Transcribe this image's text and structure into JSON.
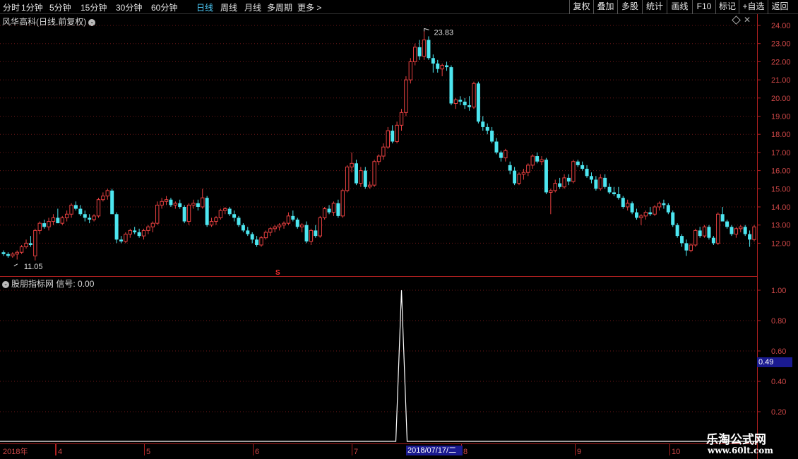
{
  "toolbar": {
    "periods": [
      "分时",
      "1分钟",
      "5分钟",
      "15分钟",
      "30分钟",
      "60分钟",
      "日线",
      "周线",
      "月线",
      "多周期",
      "更多 >"
    ],
    "active_period": "日线",
    "right_buttons": [
      "复权",
      "叠加",
      "多股",
      "统计",
      "画线",
      "F10",
      "标记",
      "+自选",
      "返回"
    ]
  },
  "main_panel": {
    "title": "风华高科(日线,前复权)",
    "y_ticks": [
      "24.00",
      "23.00",
      "22.00",
      "21.00",
      "20.00",
      "19.00",
      "18.00",
      "17.00",
      "16.00",
      "15.00",
      "14.00",
      "13.00",
      "12.00"
    ],
    "high_label": "23.83",
    "low_label": "11.05",
    "signal_mark": "S"
  },
  "indicator_panel": {
    "title": "股朋指标网",
    "signal_label": "信号: 0.00",
    "y_ticks": [
      "1.00",
      "0.80",
      "0.60",
      "0.40",
      "0.20"
    ],
    "cursor_value": "0.49"
  },
  "date_axis": {
    "year": "2018年",
    "months": [
      "4",
      "5",
      "6",
      "7",
      "8",
      "9",
      "10"
    ],
    "cursor_date": "2018/07/17/二"
  },
  "watermark": {
    "name": "乐淘公式网",
    "url": "www.60lt.com"
  },
  "chart_data": {
    "type": "candlestick",
    "y_range": [
      11.0,
      24.3
    ],
    "up_color": "#e84040",
    "down_color": "#4de6f0",
    "candles": [
      [
        11.5,
        11.6,
        11.3,
        11.4
      ],
      [
        11.4,
        11.5,
        11.2,
        11.3
      ],
      [
        11.3,
        11.5,
        11.2,
        11.4
      ],
      [
        11.4,
        11.6,
        11.1,
        11.5
      ],
      [
        11.5,
        11.9,
        11.4,
        11.8
      ],
      [
        11.8,
        12.2,
        11.7,
        12.0
      ],
      [
        12.0,
        12.4,
        11.8,
        11.9
      ],
      [
        11.3,
        12.8,
        11.05,
        12.7
      ],
      [
        12.7,
        13.2,
        12.5,
        13.1
      ],
      [
        13.1,
        13.3,
        12.8,
        12.9
      ],
      [
        12.9,
        13.4,
        12.7,
        13.2
      ],
      [
        13.2,
        13.6,
        13.0,
        13.4
      ],
      [
        13.4,
        13.9,
        13.2,
        13.1
      ],
      [
        13.1,
        13.5,
        13.0,
        13.4
      ],
      [
        13.4,
        13.8,
        13.2,
        13.6
      ],
      [
        13.6,
        14.2,
        13.4,
        14.1
      ],
      [
        14.1,
        14.3,
        13.8,
        13.9
      ],
      [
        13.9,
        14.1,
        13.5,
        13.6
      ],
      [
        13.6,
        13.8,
        13.2,
        13.4
      ],
      [
        13.4,
        13.6,
        13.1,
        13.3
      ],
      [
        13.3,
        13.6,
        13.2,
        13.5
      ],
      [
        13.5,
        14.5,
        13.4,
        14.4
      ],
      [
        14.4,
        14.8,
        14.3,
        14.6
      ],
      [
        14.6,
        15.0,
        14.4,
        14.9
      ],
      [
        14.9,
        15.0,
        13.9,
        13.6
      ],
      [
        13.6,
        13.7,
        12.0,
        12.2
      ],
      [
        12.2,
        12.4,
        12.0,
        12.1
      ],
      [
        12.1,
        12.6,
        12.0,
        12.5
      ],
      [
        12.5,
        12.8,
        12.3,
        12.7
      ],
      [
        12.7,
        12.9,
        12.5,
        12.6
      ],
      [
        12.6,
        12.8,
        12.3,
        12.4
      ],
      [
        12.4,
        12.8,
        12.2,
        12.7
      ],
      [
        12.7,
        13.0,
        12.5,
        12.9
      ],
      [
        12.9,
        13.2,
        12.6,
        13.1
      ],
      [
        13.1,
        14.3,
        13.0,
        14.1
      ],
      [
        14.1,
        14.5,
        13.9,
        14.3
      ],
      [
        14.3,
        14.6,
        14.1,
        14.4
      ],
      [
        14.4,
        14.5,
        14.0,
        14.1
      ],
      [
        14.1,
        14.3,
        13.9,
        14.2
      ],
      [
        14.2,
        14.4,
        13.9,
        14.0
      ],
      [
        14.0,
        14.1,
        13.1,
        13.2
      ],
      [
        13.2,
        14.2,
        13.0,
        14.1
      ],
      [
        14.1,
        14.4,
        13.9,
        14.2
      ],
      [
        14.2,
        14.4,
        13.8,
        14.0
      ],
      [
        14.0,
        15.0,
        13.9,
        14.5
      ],
      [
        14.5,
        14.6,
        12.9,
        13.0
      ],
      [
        13.0,
        13.4,
        12.9,
        13.2
      ],
      [
        13.2,
        13.5,
        13.0,
        13.4
      ],
      [
        13.4,
        13.9,
        13.3,
        13.8
      ],
      [
        13.8,
        14.0,
        13.6,
        13.9
      ],
      [
        13.9,
        14.0,
        13.5,
        13.6
      ],
      [
        13.6,
        13.8,
        13.2,
        13.4
      ],
      [
        13.4,
        13.5,
        12.9,
        13.0
      ],
      [
        13.0,
        13.1,
        12.6,
        12.7
      ],
      [
        12.7,
        12.9,
        12.4,
        12.5
      ],
      [
        12.5,
        12.6,
        12.0,
        12.2
      ],
      [
        12.2,
        12.4,
        11.8,
        11.9
      ],
      [
        11.9,
        12.4,
        11.8,
        12.3
      ],
      [
        12.3,
        12.7,
        12.2,
        12.6
      ],
      [
        12.6,
        12.9,
        12.4,
        12.8
      ],
      [
        12.8,
        13.0,
        12.6,
        12.9
      ],
      [
        12.9,
        13.1,
        12.7,
        13.0
      ],
      [
        13.0,
        13.2,
        12.8,
        13.1
      ],
      [
        13.1,
        13.7,
        13.0,
        13.5
      ],
      [
        13.5,
        13.8,
        13.2,
        13.3
      ],
      [
        13.3,
        13.4,
        12.8,
        12.9
      ],
      [
        12.9,
        13.1,
        12.6,
        13.0
      ],
      [
        13.0,
        13.2,
        12.0,
        12.1
      ],
      [
        12.1,
        12.8,
        11.9,
        12.7
      ],
      [
        12.7,
        13.0,
        12.3,
        12.4
      ],
      [
        12.4,
        13.5,
        12.3,
        13.4
      ],
      [
        13.4,
        14.0,
        13.3,
        13.9
      ],
      [
        13.9,
        14.1,
        13.6,
        13.7
      ],
      [
        13.7,
        14.3,
        13.5,
        14.2
      ],
      [
        14.2,
        14.4,
        13.4,
        13.5
      ],
      [
        13.5,
        15.0,
        13.4,
        14.9
      ],
      [
        14.9,
        16.3,
        14.8,
        16.2
      ],
      [
        16.2,
        17.0,
        15.9,
        16.4
      ],
      [
        16.4,
        16.6,
        15.2,
        15.3
      ],
      [
        15.3,
        16.2,
        15.1,
        16.0
      ],
      [
        16.0,
        16.2,
        15.0,
        15.1
      ],
      [
        15.1,
        15.4,
        15.0,
        15.2
      ],
      [
        15.2,
        16.6,
        15.1,
        16.5
      ],
      [
        16.5,
        16.9,
        16.3,
        16.8
      ],
      [
        16.8,
        17.5,
        16.6,
        17.3
      ],
      [
        17.3,
        18.4,
        17.2,
        18.2
      ],
      [
        18.2,
        18.5,
        17.5,
        17.6
      ],
      [
        17.6,
        18.7,
        17.5,
        18.5
      ],
      [
        18.5,
        19.4,
        18.2,
        19.2
      ],
      [
        19.2,
        21.2,
        19.0,
        21.0
      ],
      [
        21.0,
        22.2,
        20.8,
        22.0
      ],
      [
        22.0,
        23.0,
        21.8,
        22.8
      ],
      [
        22.8,
        23.2,
        22.1,
        22.3
      ],
      [
        22.3,
        23.83,
        22.1,
        23.2
      ],
      [
        23.2,
        23.4,
        22.1,
        22.2
      ],
      [
        22.2,
        22.4,
        21.4,
        21.9
      ],
      [
        21.9,
        22.1,
        21.4,
        21.6
      ],
      [
        21.6,
        21.9,
        21.2,
        21.8
      ],
      [
        21.8,
        22.0,
        21.5,
        21.7
      ],
      [
        21.7,
        21.8,
        19.6,
        19.7
      ],
      [
        19.7,
        20.0,
        19.4,
        19.9
      ],
      [
        19.9,
        20.1,
        19.6,
        19.8
      ],
      [
        19.8,
        20.0,
        19.4,
        19.6
      ],
      [
        19.6,
        20.1,
        19.3,
        19.5
      ],
      [
        19.5,
        20.9,
        19.4,
        20.8
      ],
      [
        20.8,
        20.9,
        18.6,
        18.7
      ],
      [
        18.7,
        19.0,
        18.2,
        18.4
      ],
      [
        18.4,
        18.6,
        18.0,
        18.2
      ],
      [
        18.2,
        18.4,
        17.5,
        17.6
      ],
      [
        17.6,
        17.8,
        16.9,
        17.0
      ],
      [
        17.0,
        17.1,
        16.5,
        16.7
      ],
      [
        16.7,
        17.2,
        16.5,
        17.1
      ],
      [
        16.3,
        16.5,
        15.8,
        16.0
      ],
      [
        16.0,
        16.2,
        15.2,
        15.3
      ],
      [
        15.3,
        15.9,
        15.2,
        15.8
      ],
      [
        15.8,
        16.1,
        15.5,
        15.9
      ],
      [
        15.9,
        16.4,
        15.7,
        16.3
      ],
      [
        16.3,
        16.9,
        16.1,
        16.8
      ],
      [
        16.8,
        17.0,
        16.4,
        16.5
      ],
      [
        16.5,
        16.8,
        16.3,
        16.6
      ],
      [
        16.6,
        16.7,
        14.7,
        14.8
      ],
      [
        14.8,
        15.0,
        13.6,
        14.9
      ],
      [
        14.9,
        15.5,
        14.8,
        15.3
      ],
      [
        15.3,
        15.6,
        15.0,
        15.1
      ],
      [
        15.1,
        15.8,
        15.0,
        15.6
      ],
      [
        15.6,
        15.8,
        15.2,
        15.4
      ],
      [
        15.4,
        16.6,
        15.3,
        16.5
      ],
      [
        16.5,
        16.6,
        16.2,
        16.3
      ],
      [
        16.3,
        16.5,
        16.0,
        16.1
      ],
      [
        16.1,
        16.3,
        15.6,
        15.7
      ],
      [
        15.7,
        15.9,
        15.3,
        15.5
      ],
      [
        15.5,
        15.7,
        14.9,
        15.0
      ],
      [
        15.0,
        15.8,
        14.9,
        15.6
      ],
      [
        15.6,
        15.8,
        15.0,
        15.1
      ],
      [
        15.1,
        15.3,
        14.7,
        14.8
      ],
      [
        14.8,
        15.1,
        14.6,
        14.7
      ],
      [
        14.7,
        15.1,
        14.4,
        14.5
      ],
      [
        14.5,
        14.6,
        13.9,
        14.0
      ],
      [
        14.0,
        14.4,
        13.8,
        14.2
      ],
      [
        14.2,
        14.3,
        13.6,
        13.7
      ],
      [
        13.7,
        13.9,
        13.3,
        13.4
      ],
      [
        13.4,
        13.6,
        13.0,
        13.5
      ],
      [
        13.5,
        13.8,
        13.3,
        13.7
      ],
      [
        13.7,
        14.0,
        13.5,
        13.6
      ],
      [
        13.6,
        14.1,
        13.5,
        14.0
      ],
      [
        14.0,
        14.3,
        13.8,
        14.2
      ],
      [
        14.2,
        14.4,
        13.9,
        14.1
      ],
      [
        14.1,
        14.2,
        13.6,
        13.7
      ],
      [
        13.7,
        13.8,
        12.9,
        13.0
      ],
      [
        13.0,
        13.1,
        12.3,
        12.4
      ],
      [
        12.4,
        12.5,
        11.8,
        12.0
      ],
      [
        12.0,
        12.2,
        11.3,
        11.6
      ],
      [
        11.6,
        12.0,
        11.5,
        11.9
      ],
      [
        11.9,
        12.8,
        11.8,
        12.7
      ],
      [
        12.7,
        12.9,
        12.3,
        12.4
      ],
      [
        12.4,
        13.0,
        12.3,
        12.9
      ],
      [
        12.9,
        13.0,
        12.2,
        12.3
      ],
      [
        12.3,
        12.4,
        11.9,
        12.0
      ],
      [
        12.0,
        13.7,
        11.9,
        13.6
      ],
      [
        13.6,
        14.0,
        13.4,
        13.2
      ],
      [
        13.2,
        13.3,
        12.8,
        12.9
      ],
      [
        12.9,
        13.0,
        12.4,
        12.5
      ],
      [
        12.5,
        12.9,
        12.3,
        12.8
      ],
      [
        12.8,
        13.0,
        12.6,
        12.9
      ],
      [
        12.9,
        13.0,
        12.4,
        12.5
      ],
      [
        12.5,
        12.7,
        11.8,
        12.2
      ],
      [
        12.2,
        13.0,
        12.1,
        12.9
      ]
    ],
    "indicator": {
      "type": "line",
      "y_range": [
        0,
        1.0
      ],
      "spike_at_index": 88,
      "spike_value": 1.0,
      "baseline": 0
    }
  }
}
